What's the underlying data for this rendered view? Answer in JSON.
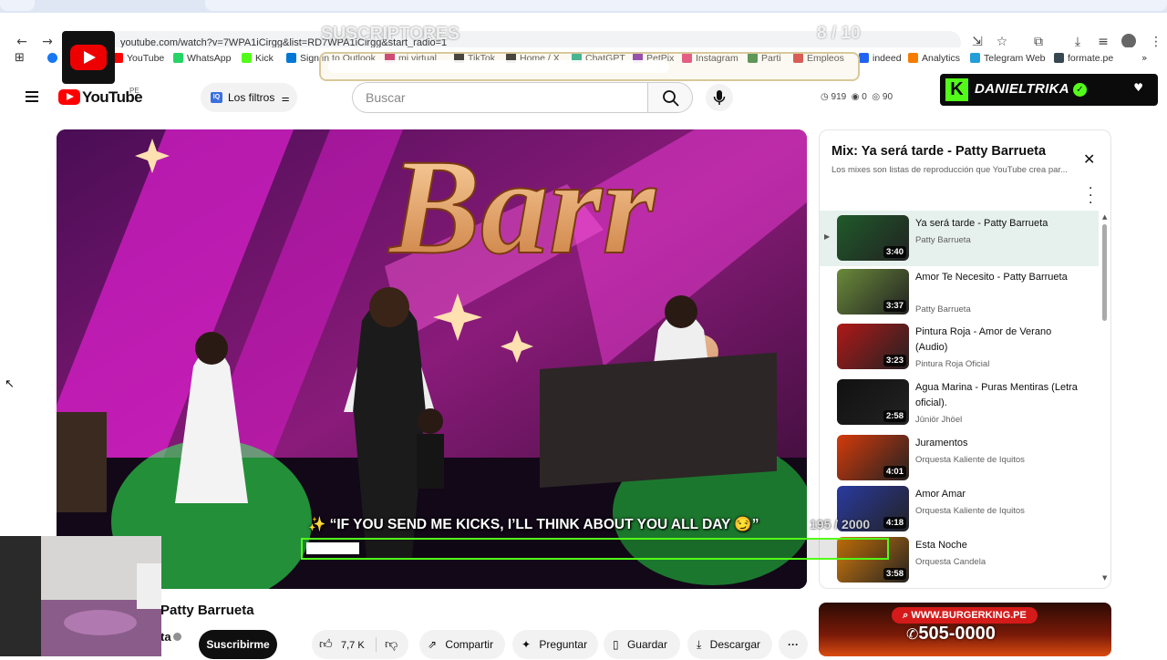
{
  "browser": {
    "url": "youtube.com/watch?v=7WPA1iCirgg&list=RD7WPA1iCirgg&start_radio=1",
    "bookmarks": [
      {
        "label": "YouTube",
        "color": "#ff0000"
      },
      {
        "label": "WhatsApp",
        "color": "#25d366"
      },
      {
        "label": "Kick",
        "color": "#53fc18"
      },
      {
        "label": "Sign in to Outlook",
        "color": "#0078d4"
      },
      {
        "label": "mi virtual",
        "color": "#c2185b"
      },
      {
        "label": "TikTok",
        "color": "#111111"
      },
      {
        "label": "Home / X",
        "color": "#111111"
      },
      {
        "label": "ChatGPT",
        "color": "#10a37f"
      },
      {
        "label": "PetPix",
        "color": "#7b1fa2"
      },
      {
        "label": "Instagram",
        "color": "#e1306c"
      },
      {
        "label": "Parti",
        "color": "#2e7d32"
      },
      {
        "label": "Empleos",
        "color": "#d32f2f"
      },
      {
        "label": "indeed",
        "color": "#2164f3"
      },
      {
        "label": "Analytics",
        "color": "#f57c00"
      },
      {
        "label": "Telegram Web",
        "color": "#229ed9"
      },
      {
        "label": "formate.pe",
        "color": "#37474f"
      }
    ]
  },
  "youtube": {
    "logo_text": "YouTube",
    "country": "PE",
    "filters_label": "Los filtros",
    "filters_badge": "IQ",
    "search_placeholder": "Buscar",
    "stats": {
      "a": "919",
      "b": "0",
      "c": "90"
    }
  },
  "playlist": {
    "title": "Mix: Ya será tarde - Patty Barrueta",
    "subtitle": "Los mixes son listas de reproducción que YouTube crea par...",
    "items": [
      {
        "title": "Ya será tarde - Patty Barrueta",
        "channel": "Patty Barrueta",
        "duration": "3:40",
        "thumb_color": "#1f5a2a",
        "selected": true
      },
      {
        "title": "Amor Te Necesito - Patty Barrueta",
        "channel": "Patty Barrueta",
        "duration": "3:37",
        "thumb_color": "#6a8a3a",
        "selected": false
      },
      {
        "title": "Pintura Roja - Amor de Verano (Audio)",
        "channel": "Pintura Roja Oficial",
        "duration": "3:23",
        "thumb_color": "#b01818",
        "selected": false
      },
      {
        "title": "Agua Marina - Puras Mentiras (Letra oficial).",
        "channel": "Jûniör Jhöel",
        "duration": "2:58",
        "thumb_color": "#111111",
        "selected": false
      },
      {
        "title": "Juramentos",
        "channel": "Orquesta Kaliente de Iquitos",
        "duration": "4:01",
        "thumb_color": "#d43a0a",
        "selected": false
      },
      {
        "title": "Amor Amar",
        "channel": "Orquesta Kaliente de Iquitos",
        "duration": "4:18",
        "thumb_color": "#2a3aa0",
        "selected": false
      },
      {
        "title": "Esta Noche",
        "channel": "Orquesta Candela",
        "duration": "3:58",
        "thumb_color": "#d47a0a",
        "selected": false
      }
    ]
  },
  "video": {
    "title": "Patty Barrueta",
    "channel_partial": "ta",
    "subscribe_label": "Suscribirme",
    "likes": "7,7 K",
    "share_label": "Compartir",
    "ask_label": "Preguntar",
    "save_label": "Guardar",
    "download_label": "Descargar"
  },
  "ad": {
    "url": "WWW.BURGERKING.PE",
    "phone": "505-0000"
  },
  "overlay": {
    "subs_label": "SUSCRIPTORES",
    "subs_count": "8",
    "subs_goal": "/ 10",
    "subs_progress": 0.8,
    "kick_user": "DANIELTRIKA",
    "kick_message": "✨ “IF YOU SEND ME KICKS, I’LL THINK ABOUT YOU ALL DAY 😏”",
    "kick_count": "195",
    "kick_goal": "/ 2000"
  }
}
